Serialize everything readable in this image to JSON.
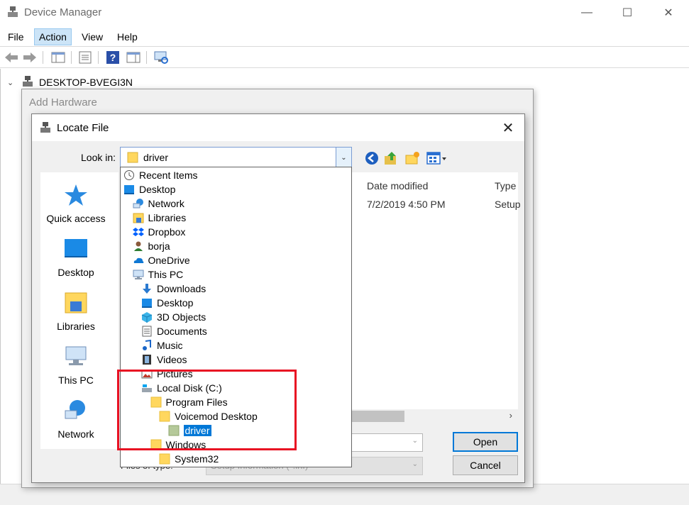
{
  "device_manager": {
    "title": "Device Manager",
    "menu": [
      "File",
      "Action",
      "View",
      "Help"
    ],
    "window_controls": {
      "minimize": "—",
      "maximize": "☐",
      "close": "✕"
    },
    "tree_root": "DESKTOP-BVEGI3N"
  },
  "add_hardware": {
    "title": "Add Hardware"
  },
  "locate_file": {
    "title": "Locate File",
    "close": "✕",
    "look_in_label": "Look in:",
    "look_in_value": "driver",
    "places": [
      {
        "label": "Quick access",
        "icon": "star-icon"
      },
      {
        "label": "Desktop",
        "icon": "desktop-icon"
      },
      {
        "label": "Libraries",
        "icon": "libraries-icon"
      },
      {
        "label": "This PC",
        "icon": "computer-icon"
      },
      {
        "label": "Network",
        "icon": "network-icon"
      }
    ],
    "columns": [
      "Date modified",
      "Type"
    ],
    "row": {
      "date": "7/2/2019 4:50 PM",
      "type": "Setup"
    },
    "file_type_label": "Files of type:",
    "file_type_value": "Setup Information (*.inf)",
    "open_button": "Open",
    "cancel_button": "Cancel"
  },
  "dropdown": [
    {
      "label": "Recent Items",
      "icon": "recent-items-icon",
      "indent": 0
    },
    {
      "label": "Desktop",
      "icon": "desktop-icon",
      "indent": 0
    },
    {
      "label": "Network",
      "icon": "network-icon",
      "indent": 1
    },
    {
      "label": "Libraries",
      "icon": "libraries-icon",
      "indent": 1
    },
    {
      "label": "Dropbox",
      "icon": "dropbox-icon",
      "indent": 1
    },
    {
      "label": "borja",
      "icon": "user-icon",
      "indent": 1
    },
    {
      "label": "OneDrive",
      "icon": "onedrive-icon",
      "indent": 1
    },
    {
      "label": "This PC",
      "icon": "computer-icon",
      "indent": 1
    },
    {
      "label": "Downloads",
      "icon": "downloads-icon",
      "indent": 2
    },
    {
      "label": "Desktop",
      "icon": "desktop-icon",
      "indent": 2
    },
    {
      "label": "3D Objects",
      "icon": "3d-objects-icon",
      "indent": 2
    },
    {
      "label": "Documents",
      "icon": "documents-icon",
      "indent": 2
    },
    {
      "label": "Music",
      "icon": "music-icon",
      "indent": 2
    },
    {
      "label": "Videos",
      "icon": "videos-icon",
      "indent": 2
    },
    {
      "label": "Pictures",
      "icon": "pictures-icon",
      "indent": 2
    },
    {
      "label": "Local Disk (C:)",
      "icon": "drive-icon",
      "indent": 2
    },
    {
      "label": "Program Files",
      "icon": "folder-icon",
      "indent": 3
    },
    {
      "label": "Voicemod Desktop",
      "icon": "folder-icon",
      "indent": 4
    },
    {
      "label": "driver",
      "icon": "folder-open-icon",
      "indent": 5,
      "selected": true
    },
    {
      "label": "Windows",
      "icon": "folder-icon",
      "indent": 3
    },
    {
      "label": "System32",
      "icon": "folder-icon",
      "indent": 4
    }
  ],
  "colors": {
    "accent": "#0078d7",
    "highlight": "#e81123",
    "folder": "#ffd75e"
  }
}
